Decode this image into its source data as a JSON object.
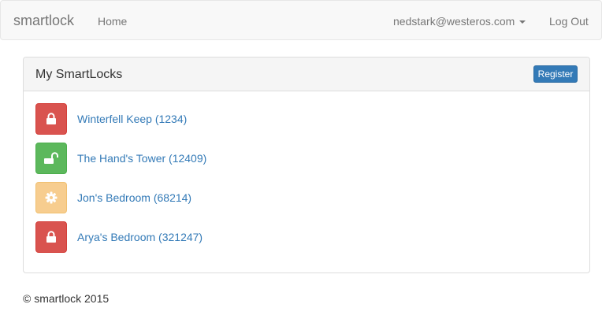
{
  "navbar": {
    "brand": "smartlock",
    "home_label": "Home",
    "user_email": "nedstark@westeros.com",
    "logout_label": "Log Out"
  },
  "panel": {
    "title": "My SmartLocks",
    "register_label": "Register"
  },
  "locks": [
    {
      "label": "Winterfell Keep (1234)",
      "status": "locked",
      "icon": "lock-icon",
      "color": "#d9534f"
    },
    {
      "label": "The Hand's Tower (12409)",
      "status": "unlocked",
      "icon": "unlock-icon",
      "color": "#5cb85c"
    },
    {
      "label": "Jon's Bedroom (68214)",
      "status": "pending",
      "icon": "gear-icon",
      "color": "#f7cd8f"
    },
    {
      "label": "Arya's Bedroom (321247)",
      "status": "locked",
      "icon": "lock-icon",
      "color": "#d9534f"
    }
  ],
  "footer": {
    "text": "© smartlock 2015"
  },
  "colors": {
    "link": "#337ab7",
    "nav_text": "#777777",
    "primary": "#337ab7"
  }
}
